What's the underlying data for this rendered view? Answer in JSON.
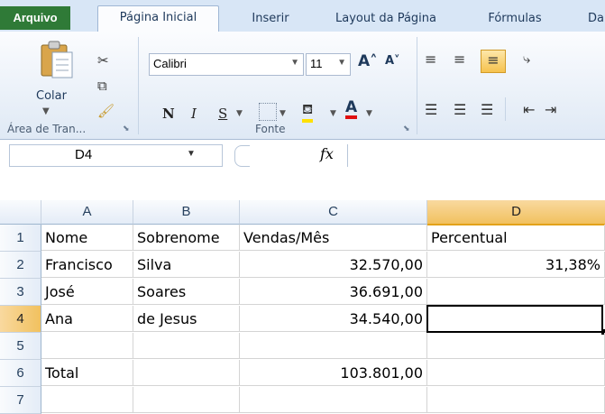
{
  "tabs": {
    "file": "Arquivo",
    "home": "Página Inicial",
    "insert": "Inserir",
    "layout": "Layout da Página",
    "formulas": "Fórmulas",
    "data": "Da"
  },
  "ribbon": {
    "clipboard": {
      "paste_label": "Colar",
      "group_label": "Área de Tran..."
    },
    "font": {
      "font_name": "Calibri",
      "font_size": "11",
      "group_label": "Fonte",
      "bold": "N",
      "italic": "I",
      "underline": "S"
    }
  },
  "formula_bar": {
    "name_box": "D4",
    "fx": "fx"
  },
  "sheet": {
    "columns": [
      "A",
      "B",
      "C",
      "D"
    ],
    "rows": [
      "1",
      "2",
      "3",
      "4",
      "5",
      "6",
      "7"
    ],
    "cells": [
      [
        "Nome",
        "Sobrenome",
        "Vendas/Mês",
        "Percentual"
      ],
      [
        "Francisco",
        "Silva",
        "32.570,00",
        "31,38%"
      ],
      [
        "José",
        "Soares",
        "36.691,00",
        ""
      ],
      [
        "Ana",
        "de Jesus",
        "34.540,00",
        ""
      ],
      [
        "",
        "",
        "",
        ""
      ],
      [
        "Total",
        "",
        "103.801,00",
        ""
      ],
      [
        "",
        "",
        "",
        ""
      ]
    ]
  },
  "colors": {
    "file_tab": "#2f7a37",
    "selected_header": "#f1c15f",
    "ribbon": "#dfe9f5"
  }
}
